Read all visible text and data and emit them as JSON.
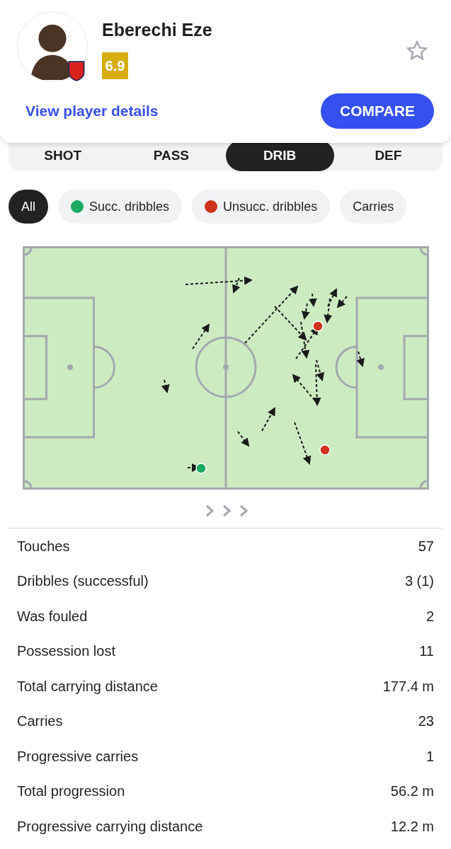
{
  "player": {
    "name": "Eberechi Eze",
    "rating": "6.9",
    "favorite": false,
    "details_link": "View player details",
    "compare_button": "COMPARE"
  },
  "tabs": [
    {
      "label": "SHOT",
      "selected": false
    },
    {
      "label": "PASS",
      "selected": false
    },
    {
      "label": "DRIB",
      "selected": true
    },
    {
      "label": "DEF",
      "selected": false
    }
  ],
  "filters": [
    {
      "label": "All",
      "selected": true
    },
    {
      "label": "Succ. dribbles",
      "selected": false,
      "color": "#1aaa63"
    },
    {
      "label": "Unsucc. dribbles",
      "selected": false,
      "color": "#d0321c"
    },
    {
      "label": "Carries",
      "selected": false
    }
  ],
  "stats": [
    {
      "label": "Touches",
      "value": "57"
    },
    {
      "label": "Dribbles (successful)",
      "value": "3 (1)"
    },
    {
      "label": "Was fouled",
      "value": "2"
    },
    {
      "label": "Possession lost",
      "value": "11"
    },
    {
      "label": "Total carrying distance",
      "value": "177.4 m"
    },
    {
      "label": "Carries",
      "value": "23"
    },
    {
      "label": "Progressive carries",
      "value": "1"
    },
    {
      "label": "Total progression",
      "value": "56.2 m"
    },
    {
      "label": "Progressive carrying distance",
      "value": "12.2 m"
    }
  ]
}
